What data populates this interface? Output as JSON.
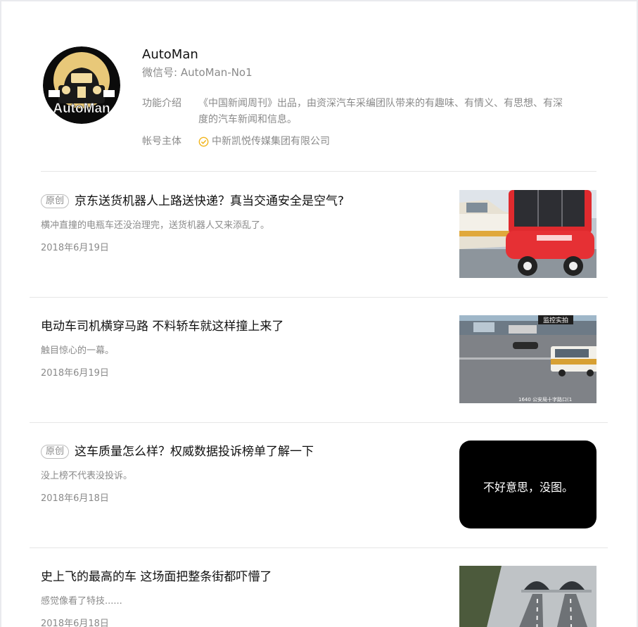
{
  "profile": {
    "name": "AutoMan",
    "wechat_id": "微信号: AutoMan-No1",
    "intro_label": "功能介绍",
    "intro_text_line1": "《中国新闻周刊》出品，由资深汽车采编团队带来的有趣味、有情义、有思想、有深",
    "intro_text_line2": "度的汽车新闻和信息。",
    "owner_label": "帐号主体",
    "owner_name": "中新凯悦传媒集团有限公司",
    "avatar_text": "AutoMan"
  },
  "articles": [
    {
      "tag": "原创",
      "title": "京东送货机器人上路送快递？真当交通安全是空气?",
      "desc": "横冲直撞的电瓶车还没治理完，送货机器人又来添乱了。",
      "date": "2018年6月19日"
    },
    {
      "tag": "",
      "title": "电动车司机横穿马路 不料轿车就这样撞上来了",
      "desc": "触目惊心的一幕。",
      "date": "2018年6月19日",
      "thumb_label": "监控实拍",
      "thumb_caption": "1640 公安局十字路口(1"
    },
    {
      "tag": "原创",
      "title": "这车质量怎么样？权威数据投诉榜单了解一下",
      "desc": "没上榜不代表没投诉。",
      "date": "2018年6月18日",
      "thumb_text": "不好意思，没图。"
    },
    {
      "tag": "",
      "title": "史上飞的最高的车 这场面把整条街都吓懵了",
      "desc": "感觉像看了特技......",
      "date": "2018年6月18日"
    }
  ]
}
